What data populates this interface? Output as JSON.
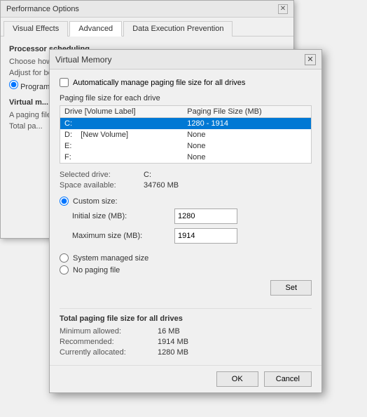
{
  "perf_window": {
    "title": "Performance Options",
    "close_label": "✕",
    "tabs": [
      {
        "label": "Visual Effects",
        "active": false
      },
      {
        "label": "Advanced",
        "active": true
      },
      {
        "label": "Data Execution Prevention",
        "active": false
      }
    ],
    "processor_section": "Processor scheduling",
    "choose_text": "Choose how to allocate processor resources.",
    "adjust_text": "Adjust for best performance of:",
    "radio_prog": "Programs",
    "virtual_section": "Virtual m...",
    "paging_text": "A paging file is an area on the hard disk that Windows uses as if it were RAM.",
    "total_text": "Total pa..."
  },
  "vm_dialog": {
    "title": "Virtual Memory",
    "close_label": "✕",
    "auto_manage_label": "Automatically manage paging file size for all drives",
    "auto_manage_checked": false,
    "paging_section": "Paging file size for each drive",
    "table_headers": [
      "Drive  [Volume Label]",
      "Paging File Size (MB)"
    ],
    "drives": [
      {
        "drive": "C:",
        "label": "",
        "paging": "1280 - 1914",
        "selected": true
      },
      {
        "drive": "D:",
        "label": "[New Volume]",
        "paging": "None",
        "selected": false
      },
      {
        "drive": "E:",
        "label": "",
        "paging": "None",
        "selected": false
      },
      {
        "drive": "F:",
        "label": "",
        "paging": "None",
        "selected": false
      }
    ],
    "selected_drive_label": "Selected drive:",
    "selected_drive_value": "C:",
    "space_available_label": "Space available:",
    "space_available_value": "34760 MB",
    "custom_size_label": "Custom size:",
    "initial_size_label": "Initial size (MB):",
    "initial_size_value": "1280",
    "max_size_label": "Maximum size (MB):",
    "max_size_value": "1914",
    "system_managed_label": "System managed size",
    "no_paging_label": "No paging file",
    "set_label": "Set",
    "total_section_title": "Total paging file size for all drives",
    "min_allowed_label": "Minimum allowed:",
    "min_allowed_value": "16 MB",
    "recommended_label": "Recommended:",
    "recommended_value": "1914 MB",
    "currently_allocated_label": "Currently allocated:",
    "currently_allocated_value": "1280 MB",
    "ok_label": "OK",
    "cancel_label": "Cancel"
  }
}
